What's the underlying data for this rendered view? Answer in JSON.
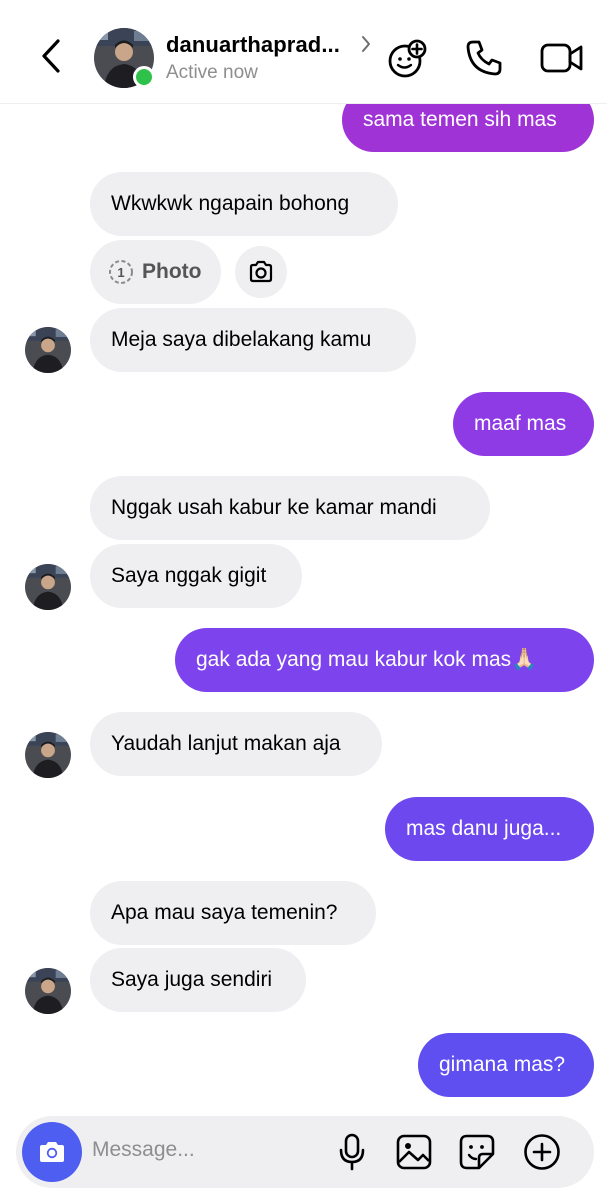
{
  "header": {
    "username": "danuarthaprad...",
    "status": "Active now",
    "icons": [
      "back-chevron-icon",
      "chevron-right-icon",
      "add-sticker-icon",
      "phone-icon",
      "video-camera-icon"
    ]
  },
  "colors": {
    "online": "#2ec24a",
    "incoming_bubble": "#efeff2",
    "outgoing_gradient": [
      "#a033d6",
      "#8e3be6",
      "#7d43ec",
      "#6c48ee",
      "#5f4ef0"
    ],
    "camera_button": "#4d5ef0"
  },
  "messages": [
    {
      "side": "out",
      "text": "sama temen sih mas"
    },
    {
      "side": "in",
      "text": "Wkwkwk ngapain bohong"
    },
    {
      "side": "in",
      "type": "photo",
      "count": "1",
      "text": "Photo"
    },
    {
      "side": "in",
      "text": "Meja saya dibelakang kamu"
    },
    {
      "side": "out",
      "text": "maaf mas"
    },
    {
      "side": "in",
      "text": "Nggak usah kabur ke kamar mandi"
    },
    {
      "side": "in",
      "text": "Saya nggak gigit"
    },
    {
      "side": "out",
      "text": "gak ada yang mau kabur kok mas🙏🏻"
    },
    {
      "side": "in",
      "text": "Yaudah lanjut makan aja"
    },
    {
      "side": "out",
      "text": "mas danu juga..."
    },
    {
      "side": "in",
      "text": "Apa mau saya temenin?"
    },
    {
      "side": "in",
      "text": "Saya juga sendiri"
    },
    {
      "side": "out",
      "text": "gimana mas?"
    }
  ],
  "composer": {
    "placeholder": "Message...",
    "icons": [
      "camera-icon",
      "microphone-icon",
      "gallery-icon",
      "sticker-icon",
      "plus-icon"
    ]
  }
}
